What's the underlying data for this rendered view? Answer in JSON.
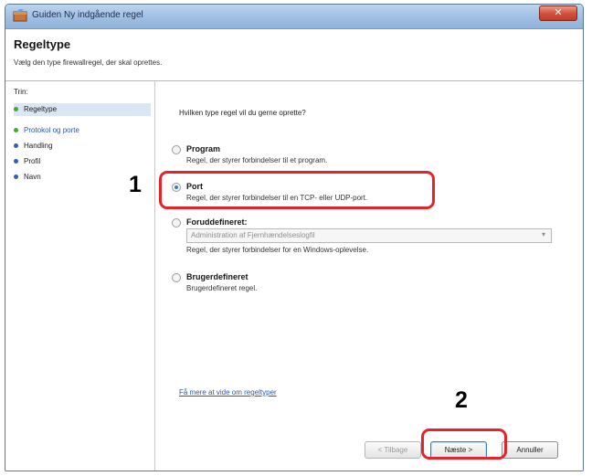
{
  "window": {
    "title": "Guiden Ny indgående regel",
    "close_label": "✕"
  },
  "header": {
    "title": "Regeltype",
    "subtitle": "Vælg den type firewallregel, der skal oprettes."
  },
  "steps": {
    "heading": "Trin:",
    "items": [
      {
        "label": "Regeltype"
      },
      {
        "label": "Protokol og porte"
      },
      {
        "label": "Handling"
      },
      {
        "label": "Profil"
      },
      {
        "label": "Navn"
      }
    ]
  },
  "content": {
    "question": "Hvilken type regel vil du gerne oprette?",
    "options": [
      {
        "title": "Program",
        "description": "Regel, der styrer forbindelser til et program.",
        "selected": false
      },
      {
        "title": "Port",
        "description": "Regel, der styrer forbindelser til en TCP- eller UDP-port.",
        "selected": true
      },
      {
        "title": "Foruddefineret:",
        "select_value": "Administration af Fjernhændelseslogfil",
        "description": "Regel, der styrer forbindelser for en Windows-oplevelse.",
        "selected": false
      },
      {
        "title": "Brugerdefineret",
        "description": "Brugerdefineret regel.",
        "selected": false
      }
    ],
    "help_link": "Få mere at vide om regeltyper"
  },
  "buttons": {
    "back": "< Tilbage",
    "next": "Næste >",
    "cancel": "Annuller"
  },
  "annotations": {
    "callout_1": "1",
    "callout_2": "2",
    "color": "#e3242b"
  }
}
